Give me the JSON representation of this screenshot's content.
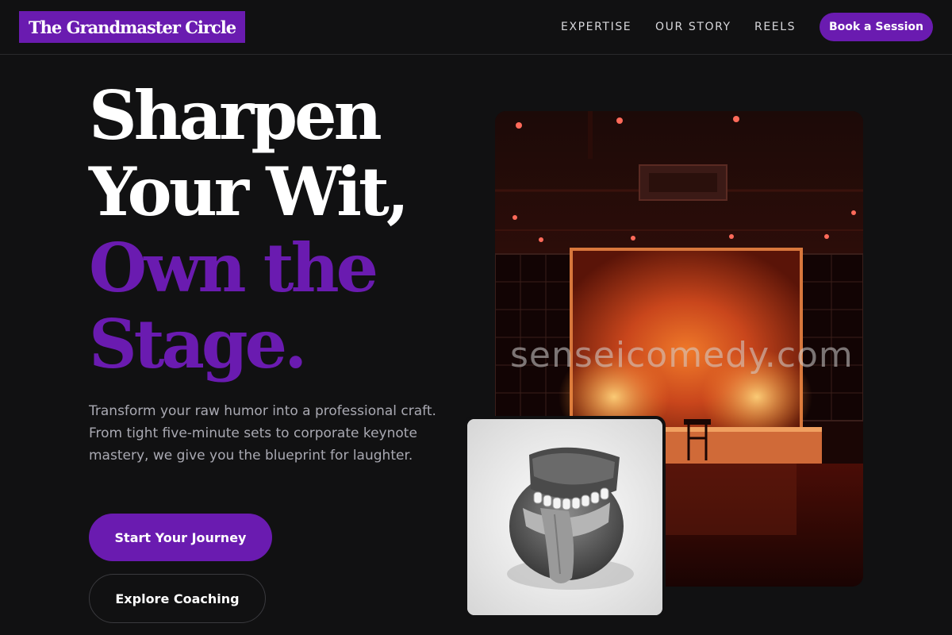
{
  "header": {
    "logo": "The Grandmaster Circle",
    "nav": [
      "EXPERTISE",
      "OUR STORY",
      "REELS"
    ],
    "book_label": "Book a Session"
  },
  "hero": {
    "headline_lines": [
      "Sharpen",
      "Your Wit,",
      "Own the",
      "Stage."
    ],
    "subtitle": "Transform your raw humor into a professional craft. From tight five-minute sets to corporate keynote mastery, we give you the blueprint for laughter.",
    "cta_primary": "Start Your Journey",
    "cta_secondary": "Explore Coaching"
  },
  "images": {
    "stage_watermark": "senseicomedy.com"
  },
  "colors": {
    "accent": "#6a1bb0",
    "background": "#111112",
    "subtitle_text": "#a9a9b2"
  }
}
